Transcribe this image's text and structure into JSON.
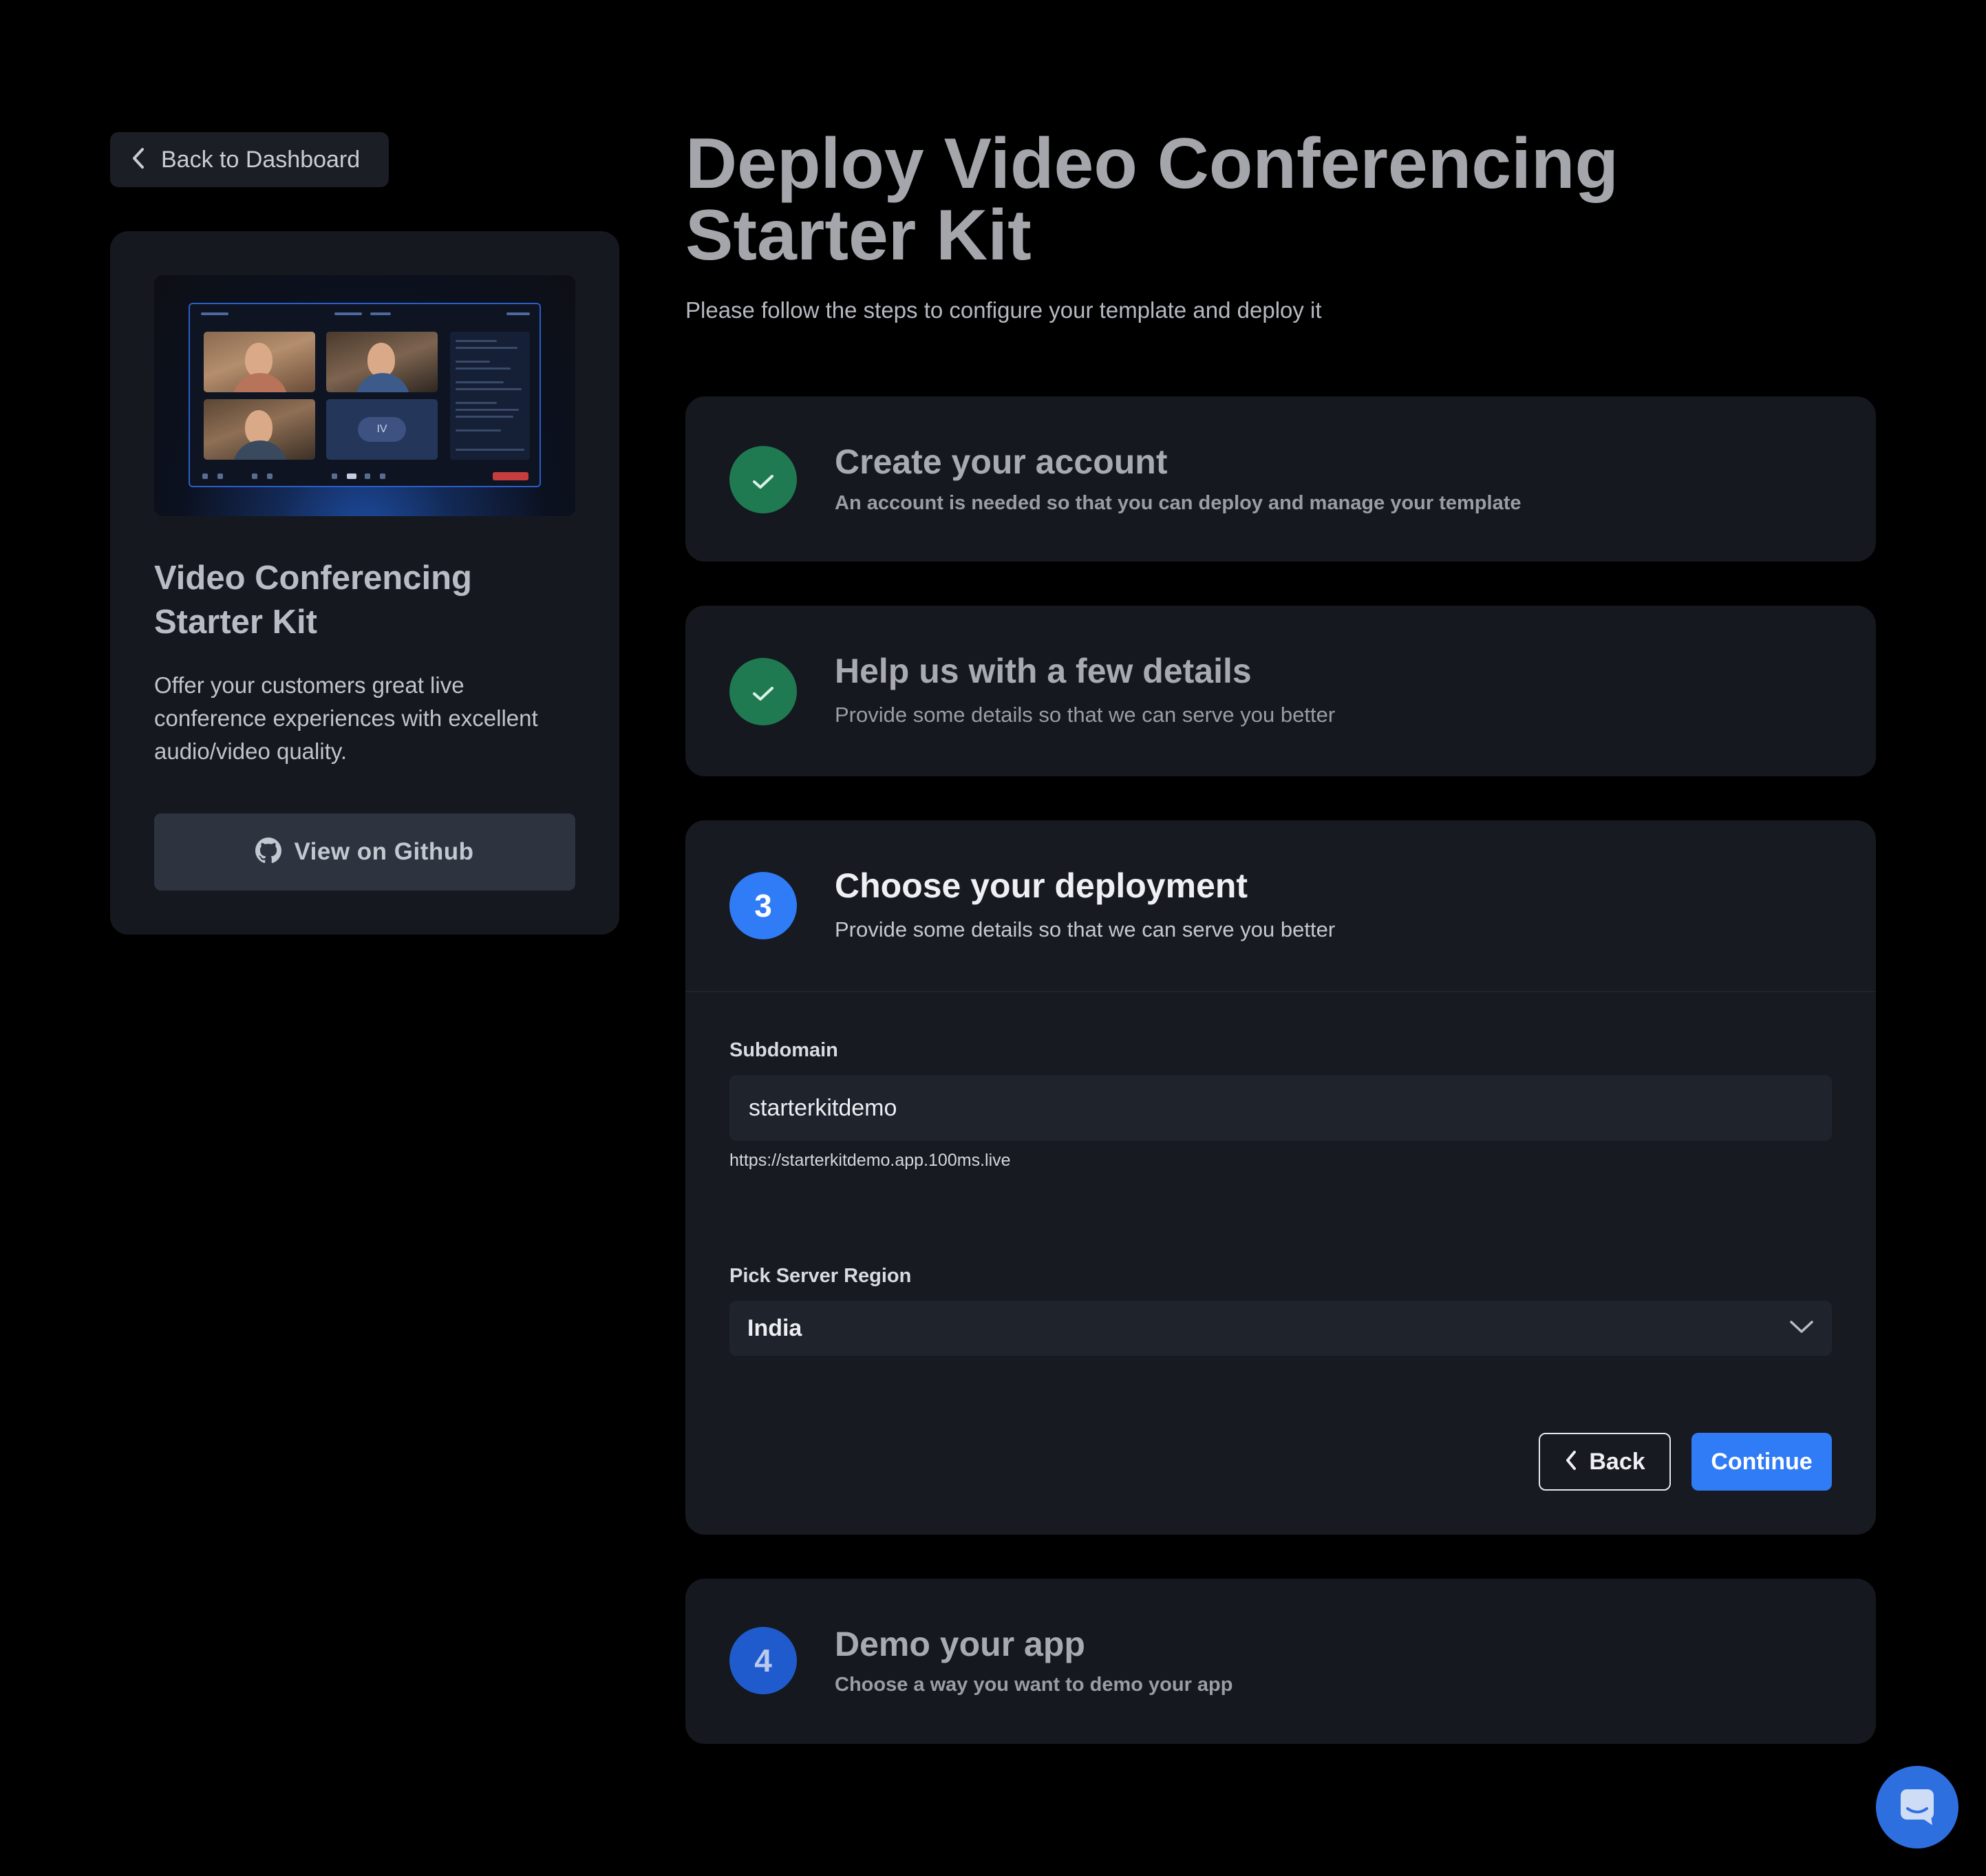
{
  "nav": {
    "back_to_dashboard": "Back to Dashboard"
  },
  "kit": {
    "preview_tile_label": "IV",
    "title": "Video Conferencing Starter Kit",
    "description": "Offer your customers great live conference experiences with excellent audio/video quality.",
    "github_button": "View on Github"
  },
  "header": {
    "title": "Deploy Video Conferencing Starter Kit",
    "subtitle": "Please follow the steps to configure your template and deploy it"
  },
  "steps": [
    {
      "title": "Create your account",
      "description": "An account is needed so that you can deploy and manage your template",
      "status": "done"
    },
    {
      "title": "Help us with a few details",
      "description": "Provide some details so that we can serve you better",
      "status": "done"
    },
    {
      "number": "3",
      "title": "Choose your deployment",
      "description": "Provide some details so that we can serve you better",
      "status": "active"
    },
    {
      "number": "4",
      "title": "Demo your app",
      "description": "Choose a way you want to demo your app",
      "status": "pending"
    }
  ],
  "form": {
    "subdomain_label": "Subdomain",
    "subdomain_value": "starterkitdemo",
    "subdomain_hint": "https://starterkitdemo.app.100ms.live",
    "region_label": "Pick Server Region",
    "region_value": "India",
    "back_button": "Back",
    "continue_button": "Continue"
  },
  "colors": {
    "background": "#000000",
    "card": "#15181e",
    "accent": "#2f7cf6",
    "success": "#1f7a52"
  },
  "icons": {
    "back": "chevron-left-icon",
    "github": "github-icon",
    "check": "check-icon",
    "dropdown": "chevron-down-icon",
    "chat": "chat-icon"
  }
}
